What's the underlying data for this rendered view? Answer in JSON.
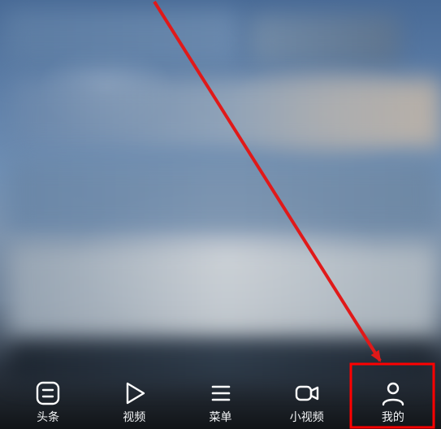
{
  "nav": {
    "items": [
      {
        "id": "headlines",
        "label": "头条",
        "icon": "headlines-icon"
      },
      {
        "id": "video",
        "label": "视频",
        "icon": "video-play-icon"
      },
      {
        "id": "menu",
        "label": "菜单",
        "icon": "hamburger-menu-icon"
      },
      {
        "id": "short-video",
        "label": "小视频",
        "icon": "camera-video-icon"
      },
      {
        "id": "mine",
        "label": "我的",
        "icon": "person-icon"
      }
    ]
  },
  "annotation": {
    "highlight_target": "mine",
    "box_color": "#ff0000",
    "arrow_color": "#e01919"
  }
}
